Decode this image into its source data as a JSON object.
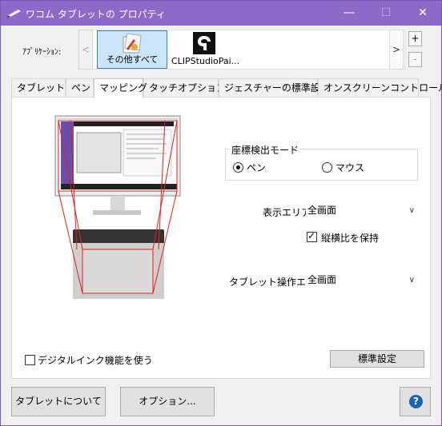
{
  "window": {
    "title": "ワコム タブレットの プロパティ",
    "controls": {
      "minimize": "—",
      "maximize": "☐",
      "close": "✕"
    }
  },
  "applications": {
    "label": "ｱﾌﾟﾘｹｰｼｮﾝ:",
    "scroll_left": "<",
    "scroll_right": ">",
    "add": "+",
    "remove": "-",
    "items": [
      {
        "label": "その他すべて",
        "icon": "all-other-apps-icon",
        "selected": true
      },
      {
        "label": "CLIPStudioPai...",
        "icon": "clip-studio-icon",
        "selected": false
      }
    ]
  },
  "tabs": [
    {
      "label": "タブレット",
      "active": false
    },
    {
      "label": "ペン",
      "active": false
    },
    {
      "label": "マッピング",
      "active": true
    },
    {
      "label": "タッチオプション",
      "active": false
    },
    {
      "label": "ジェスチャーの標準設定",
      "active": false
    },
    {
      "label": "オンスクリーンコントロール",
      "active": false
    }
  ],
  "mapping": {
    "mode_group_title": "座標検出モード",
    "mode_pen": "ペン",
    "mode_mouse": "マウス",
    "mode_selected": "ペン",
    "display_area_label": "表示エリア:",
    "display_area_value": "全画面",
    "keep_aspect_label": "縦横比を保持",
    "keep_aspect_checked": true,
    "tablet_area_label": "タブレット操作エリア:",
    "tablet_area_value": "全画面",
    "digital_ink_label": "デジタルインク機能を使う",
    "digital_ink_checked": false,
    "default_button": "標準設定"
  },
  "footer": {
    "about_button": "タブレットについて",
    "options_button": "オプション...",
    "help_icon": "?"
  },
  "colors": {
    "titlebar": "#8c6bc8",
    "mapping_lines": "#e02020",
    "selected_tile": "#cce4f7"
  }
}
